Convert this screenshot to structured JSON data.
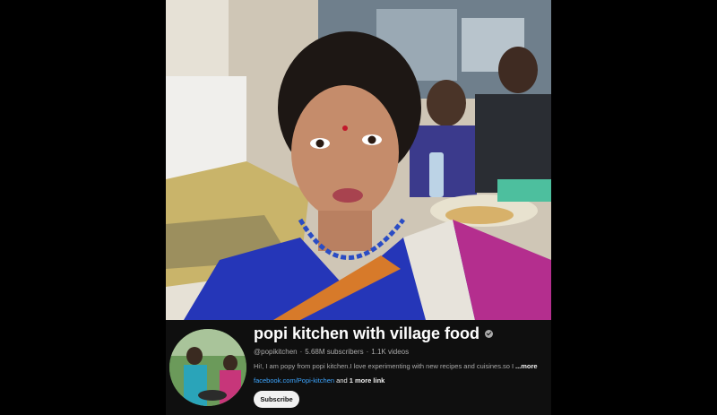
{
  "channel": {
    "name": "popi kitchen with village food",
    "handle": "@popikitchen",
    "subscribers": "5.68M subscribers",
    "videos": "1.1K videos",
    "description": "Hi!, I am popy from popi kitchen.I love experimenting with new recipes and cuisines.so I",
    "more_label": "...more",
    "link_text": "facebook.com/Popi-kitchen",
    "link_suffix": " and ",
    "more_links": "1 more link",
    "subscribe_label": "Subscribe"
  },
  "colors": {
    "background": "#0f0f0f",
    "link": "#3ea6ff",
    "subscribe_bg": "#f1f1f1"
  },
  "icons": [
    "verified-badge-icon"
  ]
}
